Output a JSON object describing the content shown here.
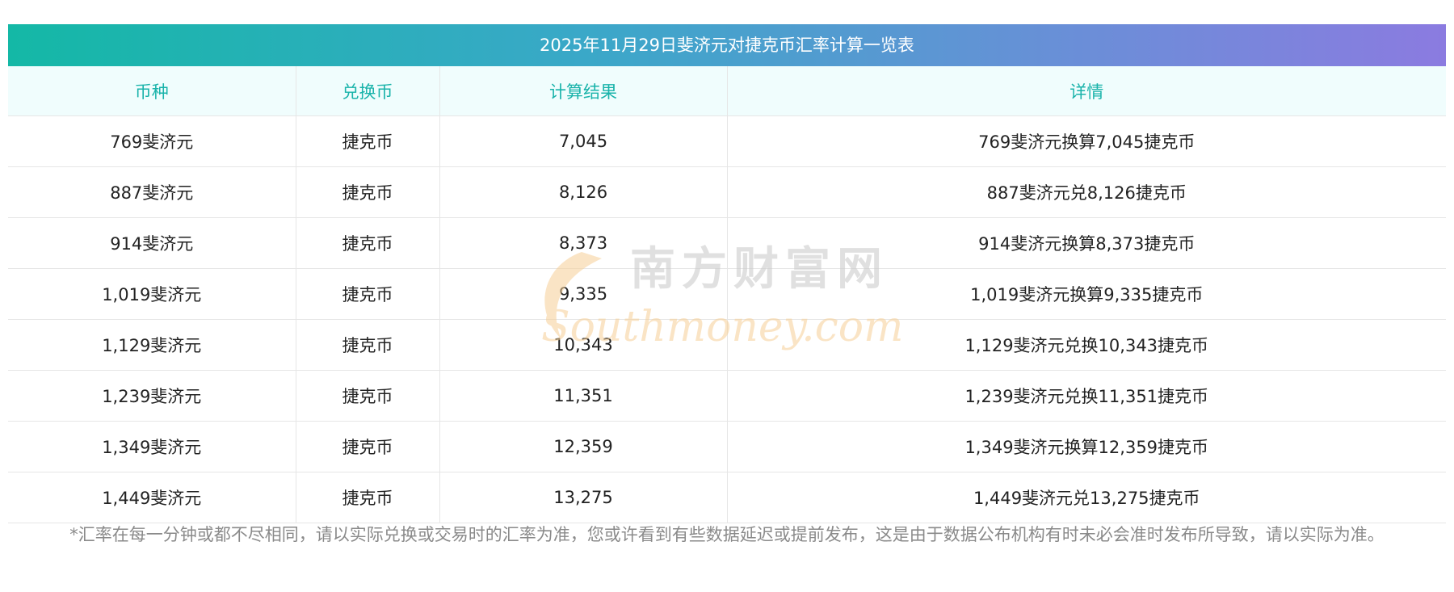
{
  "table": {
    "title": "2025年11月29日斐济元对捷克币汇率计算一览表",
    "headers": [
      "币种",
      "兑换币",
      "计算结果",
      "详情"
    ],
    "rows": [
      [
        "769斐济元",
        "捷克币",
        "7,045",
        "769斐济元换算7,045捷克币"
      ],
      [
        "887斐济元",
        "捷克币",
        "8,126",
        "887斐济元兑8,126捷克币"
      ],
      [
        "914斐济元",
        "捷克币",
        "8,373",
        "914斐济元换算8,373捷克币"
      ],
      [
        "1,019斐济元",
        "捷克币",
        "9,335",
        "1,019斐济元换算9,335捷克币"
      ],
      [
        "1,129斐济元",
        "捷克币",
        "10,343",
        "1,129斐济元兑换10,343捷克币"
      ],
      [
        "1,239斐济元",
        "捷克币",
        "11,351",
        "1,239斐济元兑换11,351捷克币"
      ],
      [
        "1,349斐济元",
        "捷克币",
        "12,359",
        "1,349斐济元换算12,359捷克币"
      ],
      [
        "1,449斐济元",
        "捷克币",
        "13,275",
        "1,449斐济元兑13,275捷克币"
      ]
    ]
  },
  "watermark": {
    "cn": "南方财富网",
    "en": "Southmoney.com"
  },
  "footnote": "*汇率在每一分钟或都不尽相同，请以实际兑换或交易时的汇率为准，您或许看到有些数据延迟或提前发布，这是由于数据公布机构有时未必会准时发布所导致，请以实际为准。",
  "colors": {
    "header_text": "#19b3aa",
    "header_bg": "#f0fdfd",
    "gradient_start": "#14b8a6",
    "gradient_end": "#8b7be0",
    "watermark": "#f5c88a"
  }
}
